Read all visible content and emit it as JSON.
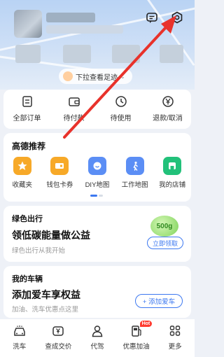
{
  "header": {
    "pull_text": "下拉查看足迹",
    "message_icon": "message-icon",
    "settings_icon": "settings-gear-icon"
  },
  "orders": {
    "items": [
      {
        "label": "全部订单",
        "icon": "document-list-icon"
      },
      {
        "label": "待付款",
        "icon": "wallet-icon"
      },
      {
        "label": "待使用",
        "icon": "clock-icon"
      },
      {
        "label": "退款/取消",
        "icon": "refund-yen-icon"
      }
    ]
  },
  "recommend": {
    "title": "高德推荐",
    "items": [
      {
        "label": "收藏夹",
        "icon": "star-icon",
        "color": "#f7a928"
      },
      {
        "label": "钱包卡券",
        "icon": "card-icon",
        "color": "#f7a928"
      },
      {
        "label": "DIY地图",
        "icon": "smile-map-icon",
        "color": "#5b8ef5"
      },
      {
        "label": "工作地图",
        "icon": "walker-icon",
        "color": "#5b8ef5"
      },
      {
        "label": "我的店铺",
        "icon": "store-icon",
        "color": "#22c17a"
      }
    ]
  },
  "green_travel": {
    "title": "绿色出行",
    "headline": "领低碳能量做公益",
    "subtitle": "绿色出行从我开始",
    "badge": "500g",
    "button": "立即领取"
  },
  "my_car": {
    "title": "我的车辆",
    "headline": "添加爱车享权益",
    "subtitle": "加油、洗车优惠点这里",
    "button": "+ 添加爱车"
  },
  "bottom_bar": {
    "items": [
      {
        "label": "洗车",
        "icon": "car-wash-icon"
      },
      {
        "label": "查成交价",
        "icon": "price-tag-icon"
      },
      {
        "label": "代驾",
        "icon": "driver-icon"
      },
      {
        "label": "优惠加油",
        "icon": "fuel-icon",
        "badge": "Hot"
      },
      {
        "label": "更多",
        "icon": "grid-more-icon"
      }
    ]
  },
  "colors": {
    "accent": "#3c78f0",
    "arrow": "#e8322b"
  }
}
